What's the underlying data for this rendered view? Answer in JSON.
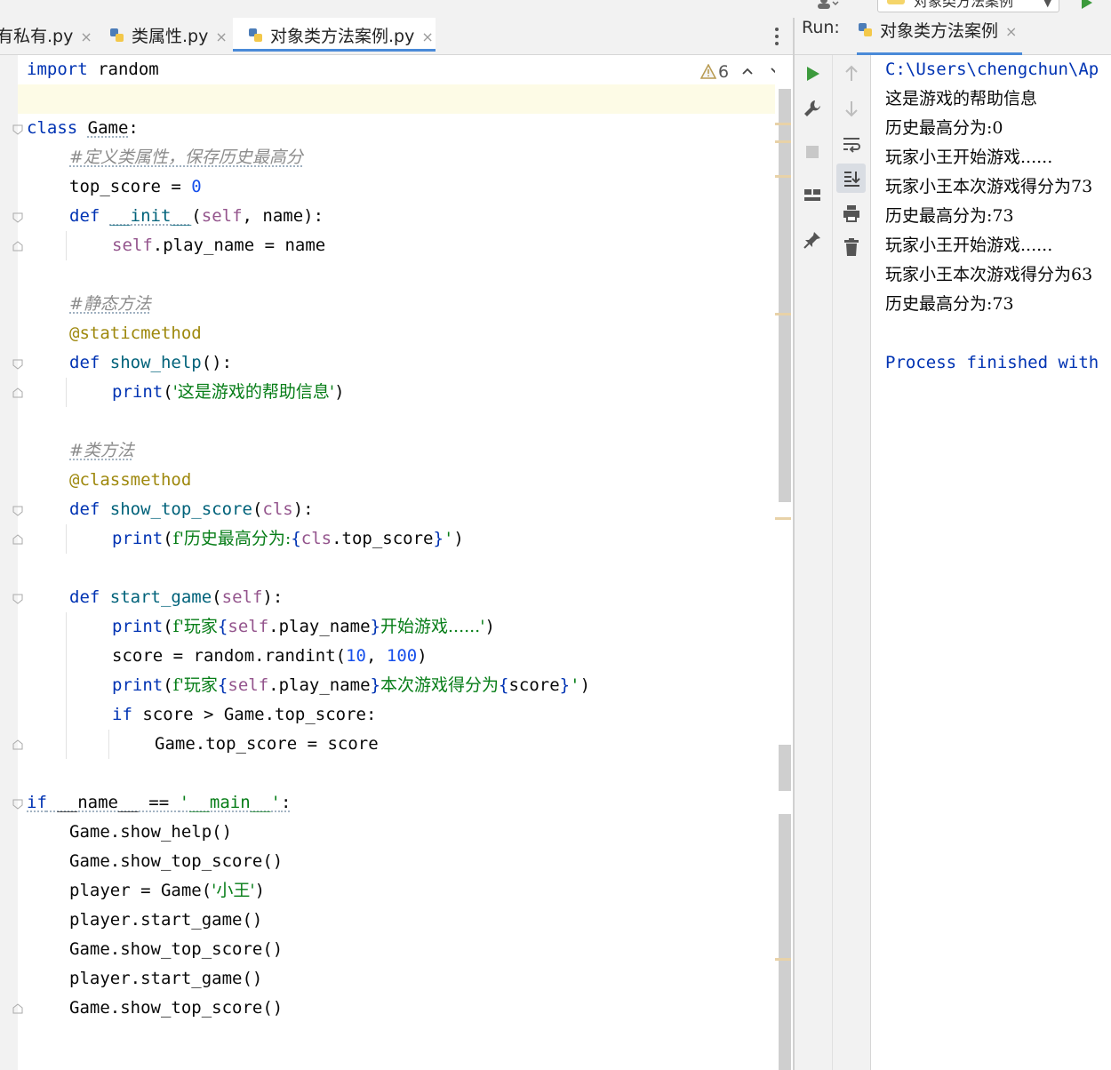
{
  "top_bar": {
    "run_config_label": "对象类方法案例"
  },
  "editor_tabs": [
    {
      "label": "有私有.py",
      "close": "×"
    },
    {
      "label": "类属性.py",
      "close": "×"
    },
    {
      "label": "对象类方法案例.py",
      "close": "×"
    }
  ],
  "inspections": {
    "warnings": "6"
  },
  "code": {
    "l1": {
      "kw": "import",
      "rest": " random"
    },
    "l3": {
      "kw": "class",
      "name": "Game",
      "colon": ":"
    },
    "l4": "#定义类属性，保存历史最高分",
    "l5": {
      "a": "top_score = ",
      "num": "0"
    },
    "l6": {
      "kw": "def",
      "fn": "__init__",
      "p1": "(",
      "self": "self",
      "rest": ", name):"
    },
    "l7": {
      "self": "self",
      "rest": ".play_name = name"
    },
    "l9": "#静态方法",
    "l10": "@staticmethod",
    "l11": {
      "kw": "def",
      "fn": "show_help",
      "rest": "():"
    },
    "l12": {
      "fn": "print",
      "p": "(",
      "str": "'这是游戏的帮助信息'",
      "e": ")"
    },
    "l14": "#类方法",
    "l15": "@classmethod",
    "l16": {
      "kw": "def",
      "fn": "show_top_score",
      "p1": "(",
      "cls": "cls",
      "rest": "):"
    },
    "l17": {
      "fn": "print",
      "p": "(",
      "s1": "f'历史最高分为:",
      "b1": "{",
      "cls": "cls",
      "m": ".top_score",
      "b2": "}",
      "s2": "'",
      "e": ")"
    },
    "l19": {
      "kw": "def",
      "fn": "start_game",
      "p1": "(",
      "self": "self",
      "rest": "):"
    },
    "l20": {
      "fn": "print",
      "p": "(",
      "s1": "f'玩家",
      "b1": "{",
      "self": "self",
      "m": ".play_name",
      "b2": "}",
      "s2": "开始游戏......'",
      "e": ")"
    },
    "l21": {
      "a": "score = random.randint(",
      "n1": "10",
      "c": ", ",
      "n2": "100",
      "e": ")"
    },
    "l22": {
      "fn": "print",
      "p": "(",
      "s1": "f'玩家",
      "b1": "{",
      "self": "self",
      "m": ".play_name",
      "b2": "}",
      "s2": "本次游戏得分为",
      "b3": "{",
      "m2": "score",
      "b4": "}",
      "s3": "'",
      "e": ")"
    },
    "l23": {
      "kw": "if",
      "rest": " score > Game.top_score:"
    },
    "l24": "Game.top_score = score",
    "l26": {
      "kw": "if",
      "a": " __name__ == ",
      "str": "'__main__'",
      "c": ":"
    },
    "l27": "Game.show_help()",
    "l28": "Game.show_top_score()",
    "l29": {
      "a": "player = Game(",
      "str": "'小王'",
      "e": ")"
    },
    "l30": "player.start_game()",
    "l31": "Game.show_top_score()",
    "l32": "player.start_game()",
    "l33": "Game.show_top_score()"
  },
  "run_panel": {
    "label": "Run:",
    "tab": "对象类方法案例",
    "close": "×"
  },
  "console": [
    "C:\\Users\\chengchun\\Ap",
    "这是游戏的帮助信息",
    "历史最高分为:0",
    "玩家小王开始游戏......",
    "玩家小王本次游戏得分为73",
    "历史最高分为:73",
    "玩家小王开始游戏......",
    "玩家小王本次游戏得分为63",
    "历史最高分为:73",
    "",
    "Process finished with"
  ],
  "colors": {
    "keyword": "#0033b3",
    "function": "#00627a",
    "string": "#067d17",
    "self": "#94558d",
    "number": "#1750eb",
    "decorator": "#9e880d",
    "comment": "#8c8c8c",
    "run_green": "#3c9a3c"
  }
}
